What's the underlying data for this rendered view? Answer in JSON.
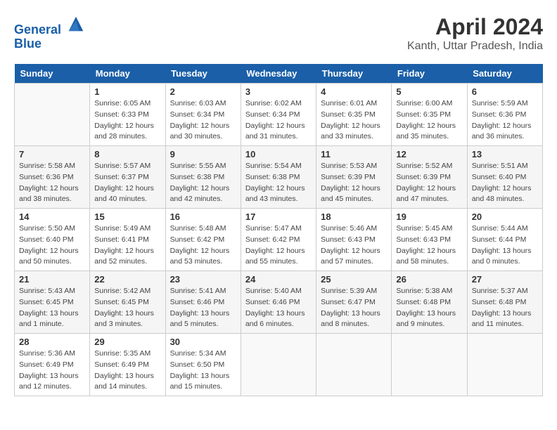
{
  "header": {
    "logo_line1": "General",
    "logo_line2": "Blue",
    "main_title": "April 2024",
    "subtitle": "Kanth, Uttar Pradesh, India"
  },
  "days_of_week": [
    "Sunday",
    "Monday",
    "Tuesday",
    "Wednesday",
    "Thursday",
    "Friday",
    "Saturday"
  ],
  "weeks": [
    [
      {
        "day": "",
        "detail": ""
      },
      {
        "day": "1",
        "detail": "Sunrise: 6:05 AM\nSunset: 6:33 PM\nDaylight: 12 hours\nand 28 minutes."
      },
      {
        "day": "2",
        "detail": "Sunrise: 6:03 AM\nSunset: 6:34 PM\nDaylight: 12 hours\nand 30 minutes."
      },
      {
        "day": "3",
        "detail": "Sunrise: 6:02 AM\nSunset: 6:34 PM\nDaylight: 12 hours\nand 31 minutes."
      },
      {
        "day": "4",
        "detail": "Sunrise: 6:01 AM\nSunset: 6:35 PM\nDaylight: 12 hours\nand 33 minutes."
      },
      {
        "day": "5",
        "detail": "Sunrise: 6:00 AM\nSunset: 6:35 PM\nDaylight: 12 hours\nand 35 minutes."
      },
      {
        "day": "6",
        "detail": "Sunrise: 5:59 AM\nSunset: 6:36 PM\nDaylight: 12 hours\nand 36 minutes."
      }
    ],
    [
      {
        "day": "7",
        "detail": "Sunrise: 5:58 AM\nSunset: 6:36 PM\nDaylight: 12 hours\nand 38 minutes."
      },
      {
        "day": "8",
        "detail": "Sunrise: 5:57 AM\nSunset: 6:37 PM\nDaylight: 12 hours\nand 40 minutes."
      },
      {
        "day": "9",
        "detail": "Sunrise: 5:55 AM\nSunset: 6:38 PM\nDaylight: 12 hours\nand 42 minutes."
      },
      {
        "day": "10",
        "detail": "Sunrise: 5:54 AM\nSunset: 6:38 PM\nDaylight: 12 hours\nand 43 minutes."
      },
      {
        "day": "11",
        "detail": "Sunrise: 5:53 AM\nSunset: 6:39 PM\nDaylight: 12 hours\nand 45 minutes."
      },
      {
        "day": "12",
        "detail": "Sunrise: 5:52 AM\nSunset: 6:39 PM\nDaylight: 12 hours\nand 47 minutes."
      },
      {
        "day": "13",
        "detail": "Sunrise: 5:51 AM\nSunset: 6:40 PM\nDaylight: 12 hours\nand 48 minutes."
      }
    ],
    [
      {
        "day": "14",
        "detail": "Sunrise: 5:50 AM\nSunset: 6:40 PM\nDaylight: 12 hours\nand 50 minutes."
      },
      {
        "day": "15",
        "detail": "Sunrise: 5:49 AM\nSunset: 6:41 PM\nDaylight: 12 hours\nand 52 minutes."
      },
      {
        "day": "16",
        "detail": "Sunrise: 5:48 AM\nSunset: 6:42 PM\nDaylight: 12 hours\nand 53 minutes."
      },
      {
        "day": "17",
        "detail": "Sunrise: 5:47 AM\nSunset: 6:42 PM\nDaylight: 12 hours\nand 55 minutes."
      },
      {
        "day": "18",
        "detail": "Sunrise: 5:46 AM\nSunset: 6:43 PM\nDaylight: 12 hours\nand 57 minutes."
      },
      {
        "day": "19",
        "detail": "Sunrise: 5:45 AM\nSunset: 6:43 PM\nDaylight: 12 hours\nand 58 minutes."
      },
      {
        "day": "20",
        "detail": "Sunrise: 5:44 AM\nSunset: 6:44 PM\nDaylight: 13 hours\nand 0 minutes."
      }
    ],
    [
      {
        "day": "21",
        "detail": "Sunrise: 5:43 AM\nSunset: 6:45 PM\nDaylight: 13 hours\nand 1 minute."
      },
      {
        "day": "22",
        "detail": "Sunrise: 5:42 AM\nSunset: 6:45 PM\nDaylight: 13 hours\nand 3 minutes."
      },
      {
        "day": "23",
        "detail": "Sunrise: 5:41 AM\nSunset: 6:46 PM\nDaylight: 13 hours\nand 5 minutes."
      },
      {
        "day": "24",
        "detail": "Sunrise: 5:40 AM\nSunset: 6:46 PM\nDaylight: 13 hours\nand 6 minutes."
      },
      {
        "day": "25",
        "detail": "Sunrise: 5:39 AM\nSunset: 6:47 PM\nDaylight: 13 hours\nand 8 minutes."
      },
      {
        "day": "26",
        "detail": "Sunrise: 5:38 AM\nSunset: 6:48 PM\nDaylight: 13 hours\nand 9 minutes."
      },
      {
        "day": "27",
        "detail": "Sunrise: 5:37 AM\nSunset: 6:48 PM\nDaylight: 13 hours\nand 11 minutes."
      }
    ],
    [
      {
        "day": "28",
        "detail": "Sunrise: 5:36 AM\nSunset: 6:49 PM\nDaylight: 13 hours\nand 12 minutes."
      },
      {
        "day": "29",
        "detail": "Sunrise: 5:35 AM\nSunset: 6:49 PM\nDaylight: 13 hours\nand 14 minutes."
      },
      {
        "day": "30",
        "detail": "Sunrise: 5:34 AM\nSunset: 6:50 PM\nDaylight: 13 hours\nand 15 minutes."
      },
      {
        "day": "",
        "detail": ""
      },
      {
        "day": "",
        "detail": ""
      },
      {
        "day": "",
        "detail": ""
      },
      {
        "day": "",
        "detail": ""
      }
    ]
  ]
}
